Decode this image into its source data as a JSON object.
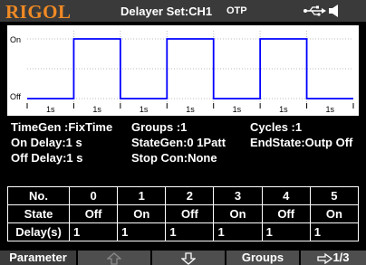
{
  "header": {
    "logo": "RIGOL",
    "title": "Delayer Set:CH1",
    "mode": "OTP",
    "icons": [
      "usb-icon",
      "speaker-icon"
    ]
  },
  "waveform": {
    "on_label": "On",
    "off_label": "Off",
    "time_labels": [
      "1s",
      "1s",
      "1s",
      "1s",
      "1s",
      "1s",
      "1s"
    ],
    "states": [
      "Off",
      "On",
      "Off",
      "On",
      "Off",
      "On",
      "Off"
    ],
    "colors": {
      "background": "#ffffff",
      "trace": "#0000ff",
      "grid": "#bbbbbb"
    }
  },
  "params": {
    "timegen": "TimeGen :FixTime",
    "groups": "Groups   :1",
    "cycles": "Cycles    :1",
    "on_delay": "On Delay:1 s",
    "stategen": "StateGen:0 1Patt",
    "endstate": "EndState:Outp Off",
    "off_delay": "Off Delay:1 s",
    "stop_con": "Stop Con:None"
  },
  "table": {
    "headers": [
      "No.",
      "0",
      "1",
      "2",
      "3",
      "4",
      "5"
    ],
    "state_label": "State",
    "states": [
      "Off",
      "On",
      "Off",
      "On",
      "Off",
      "On"
    ],
    "delay_label": "Delay(s)",
    "delays": [
      "1",
      "1",
      "1",
      "1",
      "1",
      "1"
    ]
  },
  "softkeys": {
    "parameter": "Parameter",
    "groups": "Groups",
    "page": "1/3"
  }
}
